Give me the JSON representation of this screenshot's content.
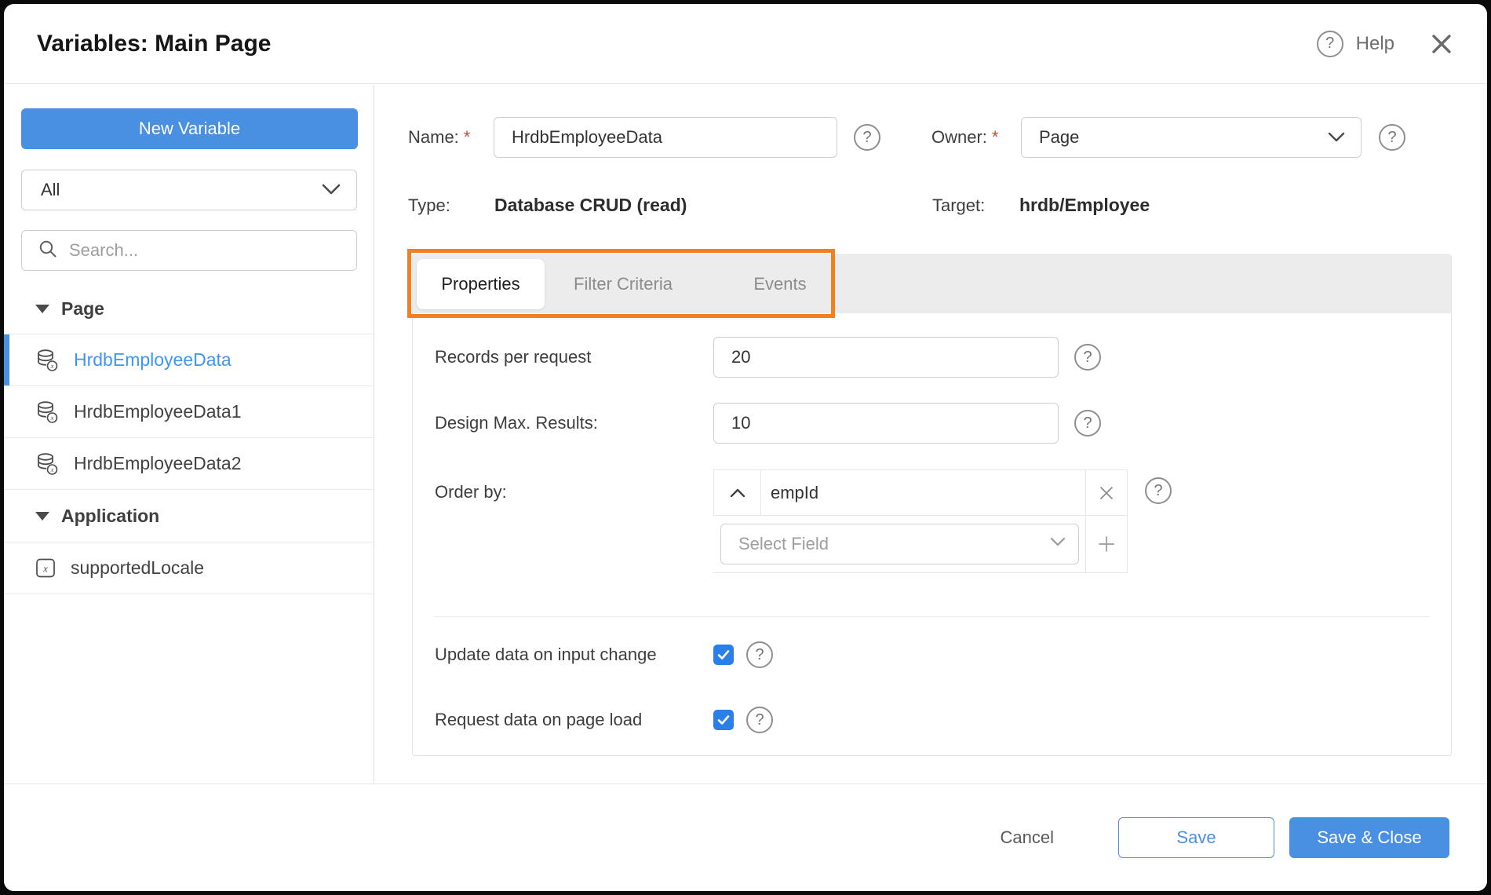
{
  "window": {
    "title": "Variables: Main Page",
    "help_label": "Help"
  },
  "sidebar": {
    "new_variable_button": "New Variable",
    "filter_dropdown_value": "All",
    "search_placeholder": "Search...",
    "sections": [
      {
        "label": "Page",
        "items": [
          {
            "label": "HrdbEmployeeData",
            "icon": "database-variable",
            "selected": true
          },
          {
            "label": "HrdbEmployeeData1",
            "icon": "database-variable",
            "selected": false
          },
          {
            "label": "HrdbEmployeeData2",
            "icon": "database-variable",
            "selected": false
          }
        ]
      },
      {
        "label": "Application",
        "items": [
          {
            "label": "supportedLocale",
            "icon": "static-variable",
            "selected": false
          }
        ]
      }
    ]
  },
  "details": {
    "name_label": "Name:",
    "name_required": "*",
    "name_value": "HrdbEmployeeData",
    "owner_label": "Owner:",
    "owner_required": "*",
    "owner_value": "Page",
    "type_label": "Type:",
    "type_value": "Database CRUD (read)",
    "target_label": "Target:",
    "target_value": "hrdb/Employee"
  },
  "tabs": {
    "properties": "Properties",
    "filter_criteria": "Filter Criteria",
    "events": "Events",
    "active_tab": "Properties"
  },
  "properties_panel": {
    "records_per_request": {
      "label": "Records per request",
      "value": "20"
    },
    "design_max_results": {
      "label": "Design Max. Results:",
      "value": "10"
    },
    "order_by": {
      "label": "Order by:",
      "entries": [
        {
          "field": "empId",
          "direction": "ascending"
        }
      ],
      "add_placeholder": "Select Field"
    },
    "update_data_on_input_change": {
      "label": "Update data on input change",
      "checked": true
    },
    "request_data_on_page_load": {
      "label": "Request data on page load",
      "checked": true
    }
  },
  "footer": {
    "cancel": "Cancel",
    "save": "Save",
    "save_and_close": "Save & Close"
  },
  "colors": {
    "accent_blue": "#4a90e2",
    "selected_item_blue": "#3d97f2",
    "checkbox_blue": "#2b7fe9",
    "highlight_orange": "#ee8123",
    "required_asterisk_red": "#d0453e",
    "tab_strip_gray": "#ececec"
  }
}
